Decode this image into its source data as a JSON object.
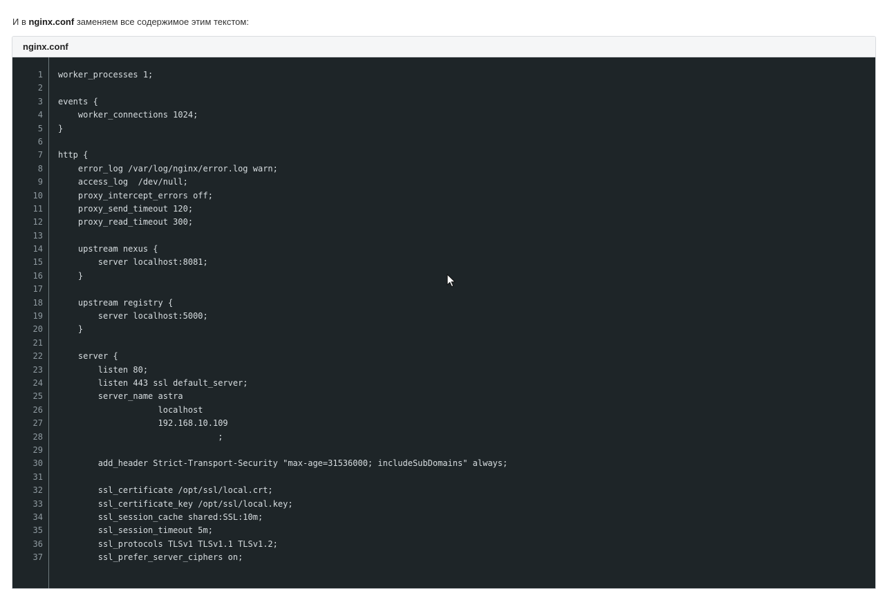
{
  "intro": {
    "prefix": "И в ",
    "filename": "nginx.conf",
    "suffix": " заменяем все содержимое этим текстом:"
  },
  "code_block": {
    "title": "nginx.conf",
    "lines": [
      {
        "number": "1",
        "text": "worker_processes 1;"
      },
      {
        "number": "2",
        "text": ""
      },
      {
        "number": "3",
        "text": "events {"
      },
      {
        "number": "4",
        "text": "    worker_connections 1024;"
      },
      {
        "number": "5",
        "text": "}"
      },
      {
        "number": "6",
        "text": ""
      },
      {
        "number": "7",
        "text": "http {"
      },
      {
        "number": "8",
        "text": "    error_log /var/log/nginx/error.log warn;"
      },
      {
        "number": "9",
        "text": "    access_log  /dev/null;"
      },
      {
        "number": "10",
        "text": "    proxy_intercept_errors off;"
      },
      {
        "number": "11",
        "text": "    proxy_send_timeout 120;"
      },
      {
        "number": "12",
        "text": "    proxy_read_timeout 300;"
      },
      {
        "number": "13",
        "text": ""
      },
      {
        "number": "14",
        "text": "    upstream nexus {"
      },
      {
        "number": "15",
        "text": "        server localhost:8081;"
      },
      {
        "number": "16",
        "text": "    }"
      },
      {
        "number": "17",
        "text": ""
      },
      {
        "number": "18",
        "text": "    upstream registry {"
      },
      {
        "number": "19",
        "text": "        server localhost:5000;"
      },
      {
        "number": "20",
        "text": "    }"
      },
      {
        "number": "21",
        "text": ""
      },
      {
        "number": "22",
        "text": "    server {"
      },
      {
        "number": "23",
        "text": "        listen 80;"
      },
      {
        "number": "24",
        "text": "        listen 443 ssl default_server;"
      },
      {
        "number": "25",
        "text": "        server_name astra"
      },
      {
        "number": "26",
        "text": "                    localhost"
      },
      {
        "number": "27",
        "text": "                    192.168.10.109"
      },
      {
        "number": "28",
        "text": "                                ;"
      },
      {
        "number": "29",
        "text": ""
      },
      {
        "number": "30",
        "text": "        add_header Strict-Transport-Security \"max-age=31536000; includeSubDomains\" always;"
      },
      {
        "number": "31",
        "text": ""
      },
      {
        "number": "32",
        "text": "        ssl_certificate /opt/ssl/local.crt;"
      },
      {
        "number": "33",
        "text": "        ssl_certificate_key /opt/ssl/local.key;"
      },
      {
        "number": "34",
        "text": "        ssl_session_cache shared:SSL:10m;"
      },
      {
        "number": "35",
        "text": "        ssl_session_timeout 5m;"
      },
      {
        "number": "36",
        "text": "        ssl_protocols TLSv1 TLSv1.1 TLSv1.2;"
      },
      {
        "number": "37",
        "text": "        ssl_prefer_server_ciphers on;"
      }
    ]
  },
  "colors": {
    "code_background": "#1e2528",
    "code_text": "#d7dde0",
    "line_number": "#8f9aa0",
    "header_background": "#f5f6f7"
  },
  "icons": {
    "cursor": "mouse-pointer-icon"
  }
}
